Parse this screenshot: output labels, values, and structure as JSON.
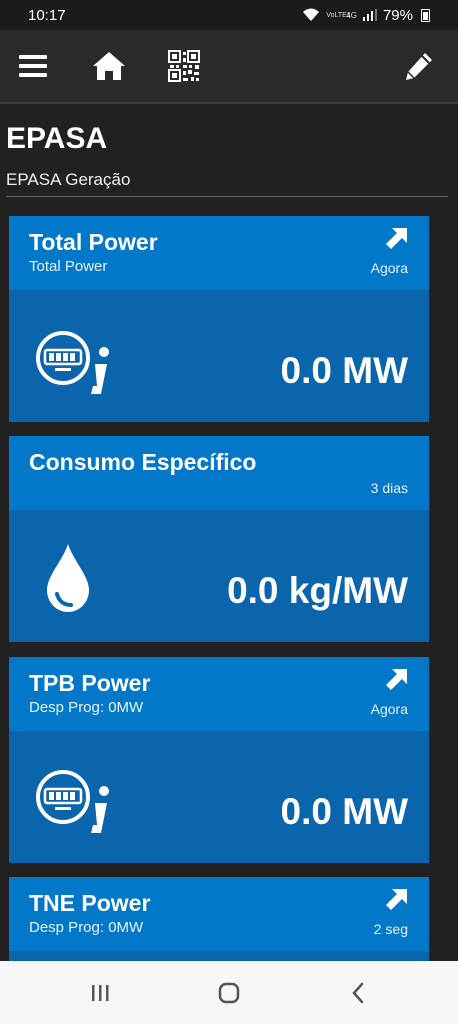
{
  "status_bar": {
    "time": "10:17",
    "network_label": "VoLTE1",
    "network_type": "4G",
    "battery": "79%"
  },
  "toolbar": {
    "icons": [
      "menu-icon",
      "home-icon",
      "qr-code-icon",
      "edit-icon"
    ]
  },
  "header": {
    "title": "EPASA",
    "subtitle": "EPASA Geração"
  },
  "cards": [
    {
      "title": "Total Power",
      "subtitle": "Total Power",
      "time": "Agora",
      "value": "0.0 MW",
      "icon": "meter-info-icon",
      "has_link": true
    },
    {
      "title": "Consumo Específico",
      "subtitle": "",
      "time": "3 dias",
      "value": "0.0 kg/MW",
      "icon": "water-drop-icon",
      "has_link": false
    },
    {
      "title": "TPB Power",
      "subtitle": "Desp Prog: 0MW",
      "time": "Agora",
      "value": "0.0 MW",
      "icon": "meter-info-icon",
      "has_link": true
    },
    {
      "title": "TNE Power",
      "subtitle": "Desp Prog: 0MW",
      "time": "2 seg",
      "value": "",
      "icon": "meter-info-icon",
      "has_link": true
    }
  ],
  "colors": {
    "background": "#212121",
    "toolbar": "#2a2a2a",
    "card_header": "#0478c8",
    "card_body": "#0a65ad",
    "nav_bar": "#f7f7f7"
  }
}
